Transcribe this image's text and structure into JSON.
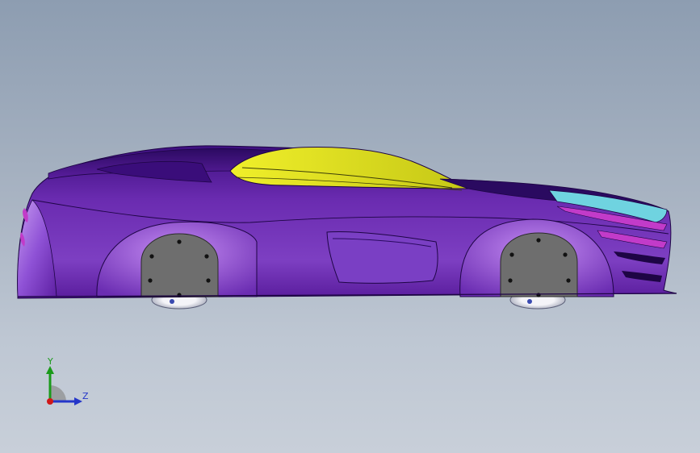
{
  "viewport": {
    "background_top": "#8d9db1",
    "background_bottom": "#c8cfd9"
  },
  "model": {
    "body_color": "#6a2bb0",
    "window_color": "#d6d81a",
    "wheel_color": "#6e6e6e",
    "accent_color": "#c23bc9",
    "light_color": "#6fd3e0"
  },
  "triad": {
    "y_label": "Y",
    "z_label": "Z",
    "y_color": "#1a9a1a",
    "z_color": "#2436c9",
    "origin_color": "#d01818"
  }
}
